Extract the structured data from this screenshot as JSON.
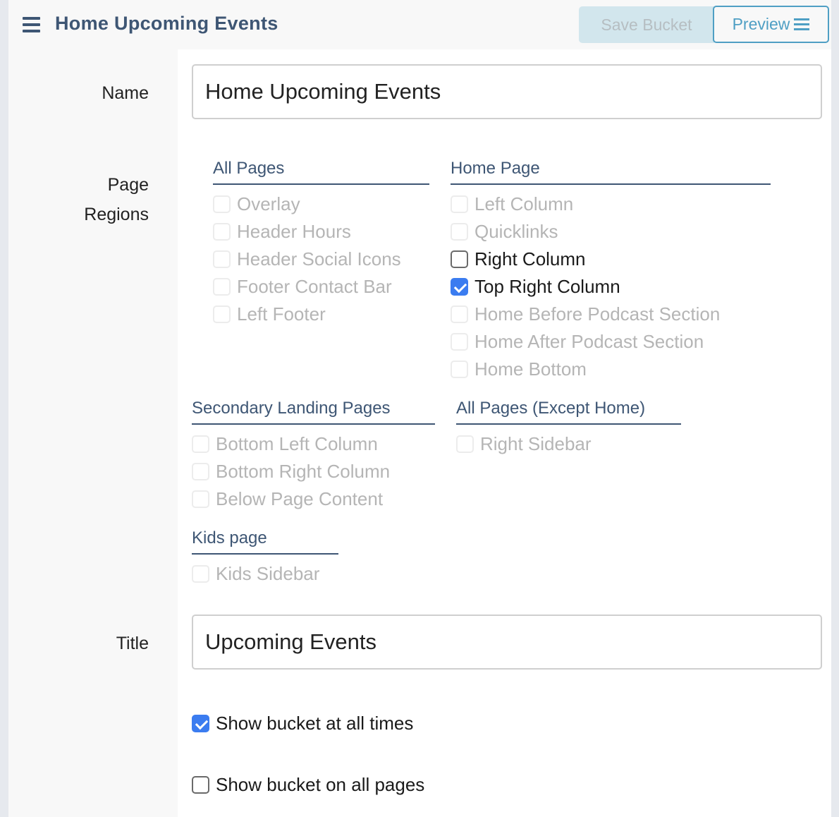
{
  "header": {
    "title": "Home Upcoming Events",
    "save_label": "Save Bucket",
    "preview_label": "Preview"
  },
  "form": {
    "name_label": "Name",
    "name_value": "Home Upcoming Events",
    "regions_label_line1": "Page",
    "regions_label_line2": "Regions",
    "title_label": "Title",
    "title_value": "Upcoming Events"
  },
  "region_groups": [
    {
      "title": "All Pages",
      "options": [
        {
          "label": "Overlay",
          "checked": false,
          "disabled": true
        },
        {
          "label": "Header Hours",
          "checked": false,
          "disabled": true
        },
        {
          "label": "Header Social Icons",
          "checked": false,
          "disabled": true
        },
        {
          "label": "Footer Contact Bar",
          "checked": false,
          "disabled": true
        },
        {
          "label": "Left Footer",
          "checked": false,
          "disabled": true
        }
      ]
    },
    {
      "title": "Home Page",
      "options": [
        {
          "label": "Left Column",
          "checked": false,
          "disabled": true
        },
        {
          "label": "Quicklinks",
          "checked": false,
          "disabled": true
        },
        {
          "label": "Right Column",
          "checked": false,
          "disabled": false
        },
        {
          "label": "Top Right Column",
          "checked": true,
          "disabled": false
        },
        {
          "label": "Home Before Podcast Section",
          "checked": false,
          "disabled": true
        },
        {
          "label": "Home After Podcast Section",
          "checked": false,
          "disabled": true
        },
        {
          "label": "Home Bottom",
          "checked": false,
          "disabled": true
        }
      ]
    },
    {
      "title": "Secondary Landing Pages",
      "options": [
        {
          "label": "Bottom Left Column",
          "checked": false,
          "disabled": true
        },
        {
          "label": "Bottom Right Column",
          "checked": false,
          "disabled": true
        },
        {
          "label": "Below Page Content",
          "checked": false,
          "disabled": true
        }
      ]
    },
    {
      "title": "All Pages (Except Home)",
      "options": [
        {
          "label": "Right Sidebar",
          "checked": false,
          "disabled": true
        }
      ]
    },
    {
      "title": "Kids page",
      "options": [
        {
          "label": "Kids Sidebar",
          "checked": false,
          "disabled": true
        }
      ]
    }
  ],
  "toggles": {
    "show_all_times": {
      "label": "Show bucket at all times",
      "checked": true
    },
    "show_all_pages": {
      "label": "Show bucket on all pages",
      "checked": false
    }
  },
  "colors": {
    "accent": "#3e5674",
    "preview": "#4f9fc4",
    "checkbox_checked": "#3b7cf0"
  }
}
